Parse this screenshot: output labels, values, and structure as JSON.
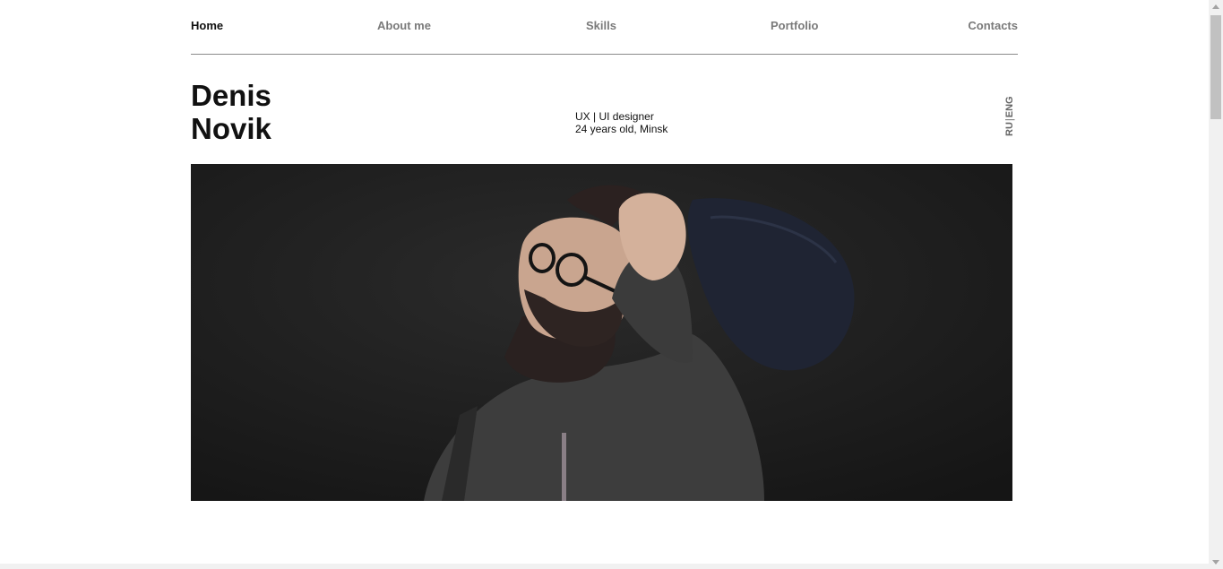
{
  "nav": {
    "items": [
      {
        "label": "Home",
        "active": true
      },
      {
        "label": "About me"
      },
      {
        "label": "Skills"
      },
      {
        "label": "Portfolio"
      },
      {
        "label": "Contacts"
      }
    ]
  },
  "profile": {
    "first_name": "Denis",
    "last_name": "Novik",
    "role": "UX | UI designer",
    "details": "24 years old, Minsk"
  },
  "language": {
    "ru": "RU",
    "separator": "|",
    "eng": "ENG"
  },
  "hero": {
    "icon": "portrait-photo-icon"
  },
  "colors": {
    "text_primary": "#111111",
    "text_muted": "#7a7a7a",
    "divider": "#8a8a8a",
    "hero_background": "#1c1c1c"
  }
}
